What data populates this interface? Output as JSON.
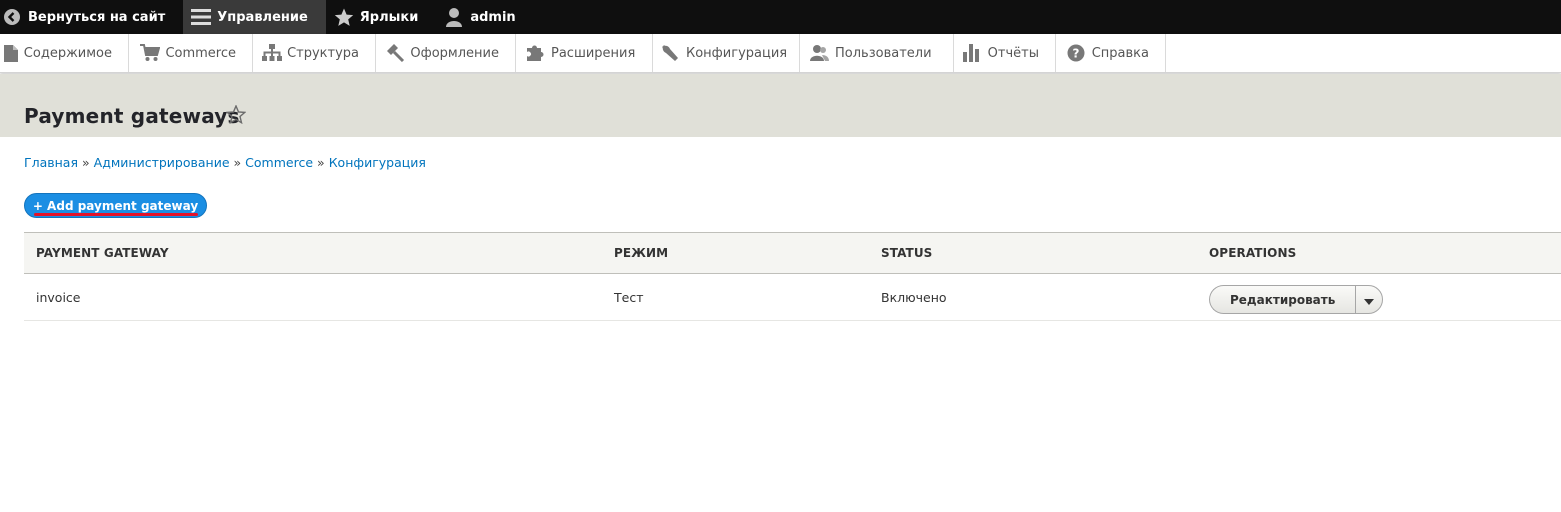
{
  "toolbar": {
    "back": "Вернуться на сайт",
    "manage": "Управление",
    "shortcuts": "Ярлыки",
    "user": "admin"
  },
  "tray": {
    "items": [
      {
        "label": "Содержимое",
        "icon": "page-icon"
      },
      {
        "label": "Commerce",
        "icon": "cart-icon"
      },
      {
        "label": "Структура",
        "icon": "sitemap-icon"
      },
      {
        "label": "Оформление",
        "icon": "brush-icon"
      },
      {
        "label": "Расширения",
        "icon": "puzzle-icon"
      },
      {
        "label": "Конфигурация",
        "icon": "wrench-icon"
      },
      {
        "label": "Пользователи",
        "icon": "people-icon"
      },
      {
        "label": "Отчёты",
        "icon": "bar-chart-icon"
      },
      {
        "label": "Справка",
        "icon": "help-icon"
      }
    ]
  },
  "page": {
    "title": "Payment gateways"
  },
  "breadcrumb": {
    "items": [
      "Главная",
      "Администрирование",
      "Commerce",
      "Конфигурация"
    ],
    "separator": "»"
  },
  "actions": {
    "add_label": "+ Add payment gateway"
  },
  "table": {
    "headers": [
      "PAYMENT GATEWAY",
      "РЕЖИМ",
      "STATUS",
      "OPERATIONS"
    ],
    "rows": [
      {
        "name": "invoice",
        "mode": "Тест",
        "status": "Включено",
        "operation": "Редактировать"
      }
    ]
  },
  "colors": {
    "toolbar_bg": "#0f0f0f",
    "accent_blue": "#1b8ee3",
    "link": "#0074bd",
    "header_bg": "#e0e0d8",
    "underline_red": "#e3122a"
  }
}
